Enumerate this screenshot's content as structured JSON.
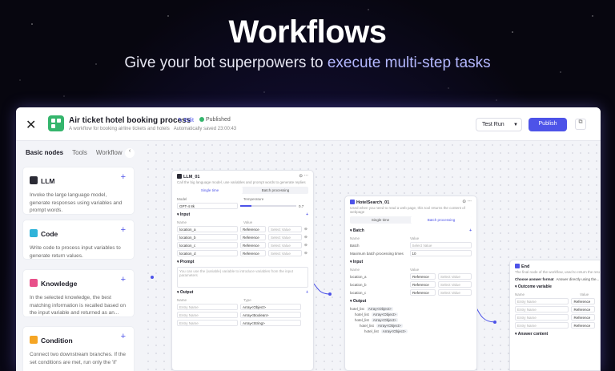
{
  "hero": {
    "title": "Workflows",
    "subtitle_plain": "Give your bot superpowers to ",
    "subtitle_highlight": "execute multi-step tasks"
  },
  "topbar": {
    "close_icon": "close-icon",
    "title": "Air ticket hotel booking process",
    "edit_label": "Edit",
    "status": "Published",
    "description": "A workflow for booking airline tickets and hotels",
    "autosave": "Automatically saved 23:00:43",
    "test_run_label": "Test Run",
    "publish_label": "Publish",
    "colors": {
      "accent": "#4d53e8",
      "app_icon": "#34b56c"
    }
  },
  "sidebar": {
    "tabs": [
      "Basic nodes",
      "Tools",
      "Workflow"
    ],
    "cards": [
      {
        "name": "LLM",
        "icon": "llm-icon",
        "color": "#2b2b35",
        "desc": "Invoke the large language model, generate responses using variables and prompt words."
      },
      {
        "name": "Code",
        "icon": "code-icon",
        "color": "#2fb3d9",
        "desc": "Write code to process input variables to generate return values."
      },
      {
        "name": "Knowledge",
        "icon": "knowledge-icon",
        "color": "#e8508a",
        "desc": "In the selected knowledge, the best matching information is recalled based on the input variable and returned as an..."
      },
      {
        "name": "Condition",
        "icon": "condition-icon",
        "color": "#f5a524",
        "desc": "Connect two downstream branches. If the set conditions are met, run only the 'if'"
      }
    ]
  },
  "nodes": {
    "llm": {
      "title": "LLM_01",
      "desc": "Call the big language model, use variables and prompt words to generate replies",
      "modes": [
        "Single time",
        "Batch processing"
      ],
      "model_label": "Model",
      "model_value": "GPT-4 8k",
      "temperature_label": "Temperature",
      "temperature_value": "0.7",
      "input_label": "Input",
      "name_col": "Name",
      "value_col": "Value",
      "inputs": [
        "location_a",
        "location_b",
        "location_c",
        "location_d"
      ],
      "ref": "Reference",
      "select_value": "Select Value",
      "prompt_label": "Prompt",
      "prompt_text": "You can use the {variable} variable to introduce variables from the input parameters",
      "output_label": "Output",
      "type_col": "Type",
      "outputs": [
        {
          "name": "Entry Name",
          "type": "Array<Object>"
        },
        {
          "name": "Entry Name",
          "type": "Array<Boolean>"
        },
        {
          "name": "Entry Name",
          "type": "Array<String>"
        }
      ]
    },
    "hotel": {
      "title": "HotelSearch_01",
      "desc": "Used when you need to read a web page, this tool returns the content of webpage",
      "modes": [
        "Single time",
        "Batch processing"
      ],
      "batch_label": "Batch",
      "name_col": "Name",
      "value_col": "Value",
      "batch_field": "Batch",
      "select_value": "Select Value",
      "max_label": "Maximum batch processing times",
      "max_value": "10",
      "input_label": "Input",
      "inputs": [
        "location_a",
        "location_b",
        "location_c"
      ],
      "ref": "Reference",
      "output_label": "Output",
      "outputs": [
        {
          "name": "hotel_list",
          "type": "Array<Object>"
        },
        {
          "name": "hotel_list",
          "type": "Array<Object>"
        },
        {
          "name": "hotel_list",
          "type": "Array<Object>"
        },
        {
          "name": "hotel_list",
          "type": "Array<Object>"
        },
        {
          "name": "hotel_list",
          "type": "Array<Object>"
        }
      ]
    },
    "end": {
      "title": "End",
      "desc": "The final node of the workflow, used to return the result information after the...",
      "format_label": "Choose answer format",
      "format_value": "Answer directly using the...",
      "outcome_label": "Outcome variable",
      "name_col": "Name",
      "value_col": "Value",
      "rows": [
        "Entry Name",
        "Entry Name",
        "Entry Name",
        "Entry Name"
      ],
      "ref": "Reference",
      "answer_label": "Answer content"
    }
  }
}
